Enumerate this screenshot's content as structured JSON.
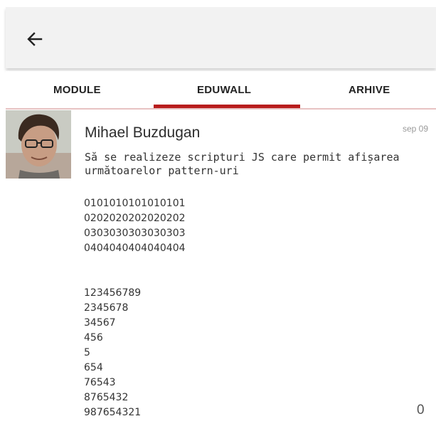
{
  "header": {
    "back_icon": "arrow-left-icon"
  },
  "tabs": [
    {
      "label": "MODULE",
      "active": false
    },
    {
      "label": "EDUWALL",
      "active": true
    },
    {
      "label": "ARHIVE",
      "active": false
    }
  ],
  "accent_color": "#b81c1c",
  "post": {
    "author": "Mihael Buzdugan",
    "date": "sep 09",
    "description": "Să se realizeze scripturi JS care permit afișarea următoarelor pattern-uri",
    "pattern1": [
      "0101010101010101",
      "0202020202020202",
      "0303030303030303",
      "0404040404040404"
    ],
    "pattern2": [
      "123456789",
      "2345678",
      "34567",
      "456",
      "5",
      "654",
      "76543",
      "8765432",
      "987654321"
    ],
    "count": "0"
  }
}
